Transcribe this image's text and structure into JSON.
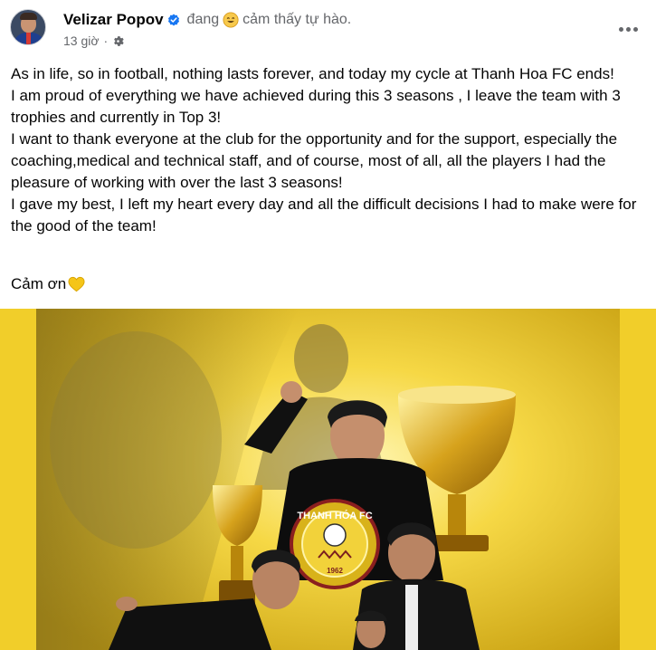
{
  "post": {
    "author": "Velizar Popov",
    "feeling_prefix": "đang",
    "feeling_emoji": "smiling-face-emoji",
    "feeling_text": "cảm thấy tự hào.",
    "timestamp": "13 giờ",
    "separator": "·",
    "privacy_icon": "gear-icon",
    "more_icon": "more-options-icon",
    "paragraphs": [
      "As in life, so in football, nothing lasts forever, and today my cycle at Thanh Hoa FC ends!",
      "I am proud of everything we have achieved during this 3 seasons , I leave the team with 3 trophies and currently in Top 3!",
      "I want to thank everyone at the club for the opportunity and for the support, especially the coaching,medical and technical staff, and of course, most of all, all the players I had the pleasure of working with over the last 3 seasons!",
      "I gave my best, I left my heart every day and all the difficult decisions I had to make were for the good of the team!"
    ],
    "closing": "Cảm ơn",
    "closing_emoji": "yellow-heart-emoji"
  },
  "image": {
    "badge_text": "THANH HÓA FC",
    "badge_year": "1962",
    "background_color": "#f1ce2a"
  },
  "colors": {
    "verified": "#1877f2",
    "secondary_text": "#65676b",
    "primary_text": "#050505"
  }
}
